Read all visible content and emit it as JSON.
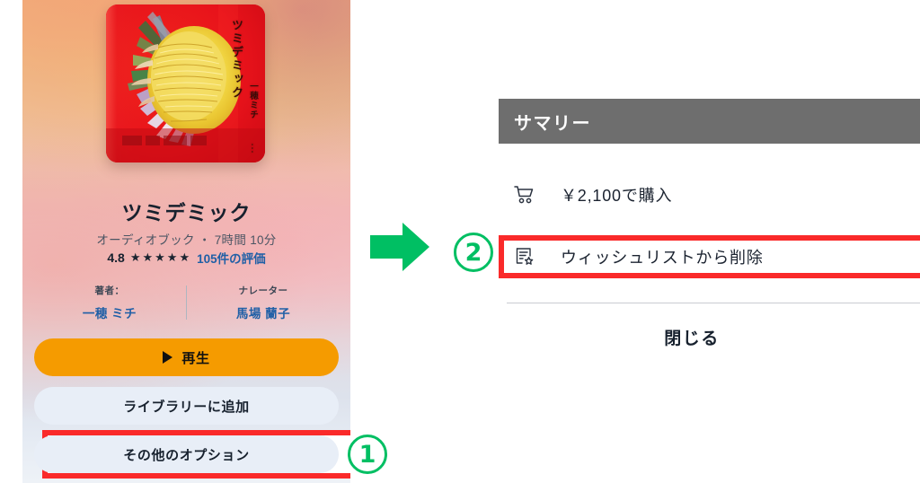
{
  "left_panel": {
    "cover": {
      "icon": "book-cover-chrysanthemum",
      "vertical_title": "ツミデミック",
      "vertical_author": "一穂ミチ",
      "vertical_dots": "･･･"
    },
    "title": "ツミデミック",
    "meta": "オーディオブック ・ 7時間 10分",
    "rating": {
      "score": "4.8",
      "stars": "★★★★★",
      "count_label": "105件の評価"
    },
    "credits": [
      {
        "label": "著者：",
        "name": "一穂 ミチ"
      },
      {
        "label": "ナレーター",
        "name": "馬場 蘭子"
      }
    ],
    "buttons": {
      "play": "再生",
      "play_icon": "play-triangle-icon",
      "library": "ライブラリーに追加",
      "more_options": "その他のオプション"
    }
  },
  "annotations": {
    "arrow_icon": "green-right-arrow-icon",
    "step_one": "1",
    "step_two": "2",
    "accent_green": "#00bf63",
    "highlight_red": "#fa2a2a"
  },
  "right_panel": {
    "header": "サマリー",
    "menu": [
      {
        "icon": "shopping-cart-icon",
        "label": "￥2,100で購入"
      },
      {
        "icon": "wishlist-star-icon",
        "label": "ウィッシュリストから削除"
      }
    ],
    "close_label": "閉じる"
  },
  "colors": {
    "play_button": "#f59b00",
    "pill_button": "#e8eef7",
    "link_blue": "#1f5fa6",
    "header_gray": "#6e6e6e"
  }
}
